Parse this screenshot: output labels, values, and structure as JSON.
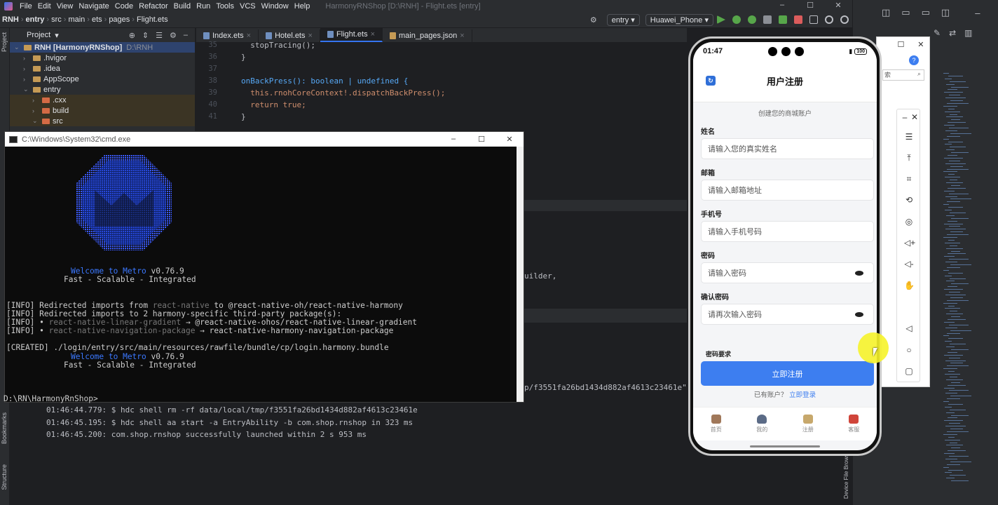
{
  "ide": {
    "menu": [
      "File",
      "Edit",
      "View",
      "Navigate",
      "Code",
      "Refactor",
      "Build",
      "Run",
      "Tools",
      "VCS",
      "Window",
      "Help"
    ],
    "window_title": "HarmonyRNShop [D:\\RNH] - Flight.ets [entry]",
    "window_controls": [
      "–",
      "☐",
      "✕"
    ],
    "breadcrumb": [
      "RNH",
      "entry",
      "src",
      "main",
      "ets",
      "pages",
      "Flight.ets"
    ],
    "run_config": "entry",
    "device": "Huawei_Phone",
    "project_panel": {
      "title": "Project",
      "items": [
        {
          "label": "RNH [HarmonyRNShop]",
          "note": "D:\\RNH",
          "level": 0,
          "chev": "⌄"
        },
        {
          "label": ".hvigor",
          "level": 1,
          "chev": "›"
        },
        {
          "label": ".idea",
          "level": 1,
          "chev": "›"
        },
        {
          "label": "AppScope",
          "level": 1,
          "chev": "›"
        },
        {
          "label": "entry",
          "level": 1,
          "chev": "⌄"
        },
        {
          "label": ".cxx",
          "level": 2,
          "chev": "›"
        },
        {
          "label": "build",
          "level": 2,
          "chev": "›"
        },
        {
          "label": "src",
          "level": 2,
          "chev": "⌄"
        }
      ]
    },
    "tabs": [
      {
        "label": "Index.ets",
        "active": false
      },
      {
        "label": "Hotel.ets",
        "active": false
      },
      {
        "label": "Flight.ets",
        "active": true
      },
      {
        "label": "main_pages.json",
        "active": false
      }
    ],
    "code": [
      {
        "ln": "35",
        "text": "  stopTracing();"
      },
      {
        "ln": "36",
        "text": "}"
      },
      {
        "ln": "37",
        "text": ""
      },
      {
        "ln": "38",
        "text": "onBackPress(): boolean | undefined {"
      },
      {
        "ln": "39",
        "text": "  this.rnohCoreContext!.dispatchBackPress();"
      },
      {
        "ln": "40",
        "text": "  return true;"
      },
      {
        "ln": "41",
        "text": "}"
      }
    ],
    "side_labels": {
      "project": "Project",
      "bookmarks": "Bookmarks",
      "structure": "Structure",
      "file_browser": "Device File Browser"
    },
    "fragments": {
      "builder": "uilder,",
      "hdc_tail": "p/f3551fa26bd1434d882af4613c23461e\" in"
    },
    "run_log": [
      "01:46:44.779: $ hdc shell rm -rf data/local/tmp/f3551fa26bd1434d882af4613c23461e",
      "01:46:45.195: $ hdc shell aa start -a EntryAbility -b com.shop.rnshop in 323 ms",
      "01:46:45.200: com.shop.rnshop successfully launched within 2 s 953 ms"
    ]
  },
  "cmd": {
    "title": "C:\\Windows\\System32\\cmd.exe",
    "controls": [
      "–",
      "☐",
      "✕"
    ],
    "welcome_1": "Welcome to Metro",
    "version": "v0.76.9",
    "tagline": "Fast - Scalable - Integrated",
    "info_1a": "[INFO] Redirected imports from ",
    "info_1b": "react-native",
    "info_1c": " to ",
    "info_1d": "@react-native-oh/react-native-harmony",
    "info_2": "[INFO] Redirected imports to 2 harmony-specific third-party package(s):",
    "info_3a": "[INFO] • ",
    "info_3b": "react-native-linear-gradient",
    "info_3c": " → @react-native-ohos/react-native-linear-gradient",
    "info_4b": "react-native-navigation-package",
    "info_4c": " → react-native-harmony-navigation-package",
    "created": "[CREATED] ./login/entry/src/main/resources/rawfile/bundle/cp/login.harmony.bundle",
    "prompt": "D:\\RN\\HarmonyRnShop>"
  },
  "phone": {
    "time": "01:47",
    "battery": "100",
    "title": "用户注册",
    "subtitle": "创建您的商城账户",
    "fields": [
      {
        "label": "姓名",
        "placeholder": "请输入您的真实姓名",
        "eye": false
      },
      {
        "label": "邮箱",
        "placeholder": "请输入邮箱地址",
        "eye": false
      },
      {
        "label": "手机号",
        "placeholder": "请输入手机号码",
        "eye": false
      },
      {
        "label": "密码",
        "placeholder": "请输入密码",
        "eye": true
      },
      {
        "label": "确认密码",
        "placeholder": "请再次输入密码",
        "eye": true
      }
    ],
    "partial_label": "密码要求",
    "register_button": "立即注册",
    "has_account": "已有账户？",
    "login_link": "立即登录",
    "tabbar": [
      {
        "label": "首页",
        "color": "#a0785a"
      },
      {
        "label": "我的",
        "color": "#5b6b86"
      },
      {
        "label": "注册",
        "color": "#c7a86c"
      },
      {
        "label": "客服",
        "color": "#d0453a"
      }
    ]
  },
  "emulator_toolbar": [
    "–",
    "✕",
    "☰",
    "⤒",
    "⌗",
    "⟲",
    "◎",
    "◁+",
    "◁-",
    "✋",
    "◁",
    "○",
    "▢"
  ],
  "browser_fragment": {
    "search_hint": "索"
  }
}
